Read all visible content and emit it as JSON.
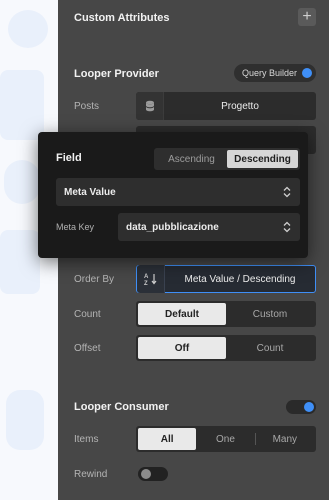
{
  "panel": {
    "custom_attributes": {
      "title": "Custom Attributes"
    },
    "looper_provider": {
      "title": "Looper Provider",
      "mode_pill": "Query Builder",
      "posts_label": "Posts",
      "posts_value": "Progetto",
      "order_by_label": "Order By",
      "order_by_value": "Meta Value / Descending",
      "count_label": "Count",
      "count_options": [
        "Default",
        "Custom"
      ],
      "count_selected": "Default",
      "offset_label": "Offset",
      "offset_options": [
        "Off",
        "Count"
      ],
      "offset_selected": "Off"
    },
    "looper_consumer": {
      "title": "Looper Consumer",
      "enabled": true,
      "items_label": "Items",
      "items_options": [
        "All",
        "One",
        "Many"
      ],
      "items_selected": "All",
      "rewind_label": "Rewind",
      "rewind_enabled": false
    }
  },
  "popover": {
    "title": "Field",
    "direction_options": [
      "Ascending",
      "Descending"
    ],
    "direction_selected": "Descending",
    "field_value": "Meta Value",
    "meta_key_label": "Meta Key",
    "meta_key_value": "data_pubblicazione"
  },
  "colors": {
    "accent": "#3f8ff7",
    "panel_bg": "#474747",
    "popover_bg": "#1a1a1a"
  },
  "icons": {
    "add": "plus-icon",
    "posts": "database-icon",
    "order": "sort-az-icon",
    "select": "chevron-updown-icon"
  }
}
